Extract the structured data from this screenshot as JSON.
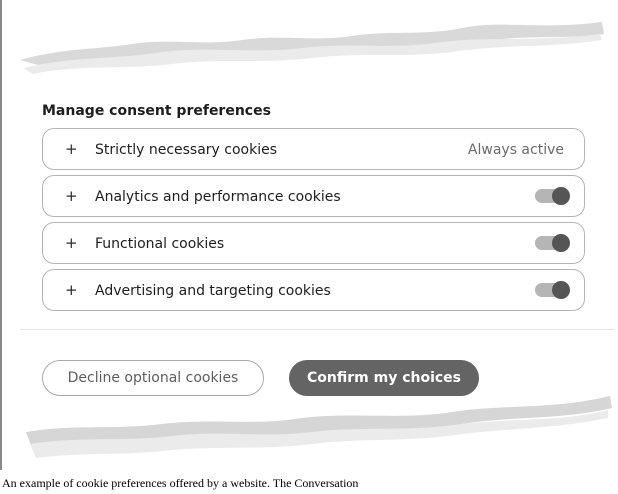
{
  "heading": "Manage consent preferences",
  "categories": [
    {
      "label": "Strictly necessary cookies",
      "expand_symbol": "+",
      "status": "Always active",
      "enabled": true,
      "locked": true
    },
    {
      "label": "Analytics and performance cookies",
      "expand_symbol": "+",
      "enabled": true,
      "locked": false
    },
    {
      "label": "Functional cookies",
      "expand_symbol": "+",
      "enabled": true,
      "locked": false
    },
    {
      "label": "Advertising and targeting cookies",
      "expand_symbol": "+",
      "enabled": true,
      "locked": false
    }
  ],
  "buttons": {
    "decline": "Decline optional cookies",
    "confirm": "Confirm my choices"
  },
  "caption": "An example of cookie preferences offered by a website. The Conversation",
  "colors": {
    "toggle_track": "#b5b5b5",
    "toggle_knob": "#555555",
    "confirm_button": "#646464",
    "border": "#b4b4b4"
  },
  "icons": {
    "expand": "plus-icon"
  }
}
